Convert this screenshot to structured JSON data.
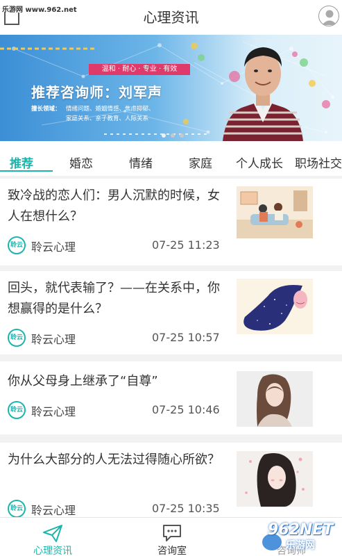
{
  "header": {
    "watermark": "乐游网 www.962.net",
    "title": "心理资讯",
    "avatar_icon": "user-avatar-icon"
  },
  "banner": {
    "tagline": "温和 · 耐心 · 专业 · 有效",
    "headline": "推荐咨询师：刘军声",
    "specialty_label": "擅长领域：",
    "specialty_line1": "情绪问题、婚姻情感、焦虑抑郁、",
    "specialty_line2": "家庭关系、亲子教育、人际关系",
    "dot_count": 3,
    "active_dot": 1
  },
  "tabs": [
    {
      "label": "推荐",
      "active": true
    },
    {
      "label": "婚恋",
      "active": false
    },
    {
      "label": "情绪",
      "active": false
    },
    {
      "label": "家庭",
      "active": false
    },
    {
      "label": "个人成长",
      "active": false
    },
    {
      "label": "职场社交",
      "active": false
    }
  ],
  "articles": [
    {
      "title": "致冷战的恋人们：男人沉默的时候，女人在想什么？",
      "source_logo": "聆云",
      "source": "聆云心理",
      "time": "07-25 11:23"
    },
    {
      "title": "回头，就代表输了？——在关系中，你想赢得的是什么？",
      "source_logo": "聆云",
      "source": "聆云心理",
      "time": "07-25 10:57"
    },
    {
      "title": "你从父母身上继承了“自尊”",
      "source_logo": "聆云",
      "source": "聆云心理",
      "time": "07-25 10:46"
    },
    {
      "title": "为什么大部分的人无法过得随心所欲？",
      "source_logo": "聆云",
      "source": "聆云心理",
      "time": "07-25 10:35"
    }
  ],
  "bottom_nav": [
    {
      "label": "心理资讯",
      "icon": "paper-plane-icon",
      "active": true
    },
    {
      "label": "咨询室",
      "icon": "chat-bubble-icon",
      "active": false
    },
    {
      "label": "咨询师",
      "icon": "counselor-icon",
      "active": false
    }
  ],
  "site_watermark": {
    "number": "962NET",
    "site": "乐游网"
  },
  "colors": {
    "accent": "#1cb5ac",
    "banner_tag": "#e03a6a",
    "banner_blue": "#3c8fd6"
  }
}
